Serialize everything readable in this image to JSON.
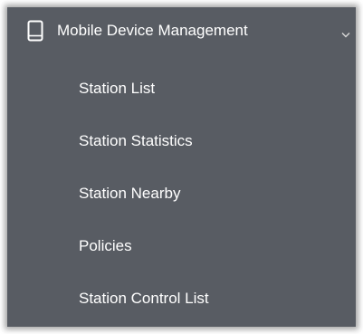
{
  "menu": {
    "header": {
      "label": "Mobile Device Management",
      "icon": "mobile-device-icon",
      "expand_icon": "chevron-down-icon"
    },
    "items": [
      {
        "label": "Station List"
      },
      {
        "label": "Station Statistics"
      },
      {
        "label": "Station Nearby"
      },
      {
        "label": "Policies"
      },
      {
        "label": "Station Control List"
      }
    ]
  },
  "colors": {
    "panel_background": "#585c63",
    "text": "#ffffff"
  }
}
